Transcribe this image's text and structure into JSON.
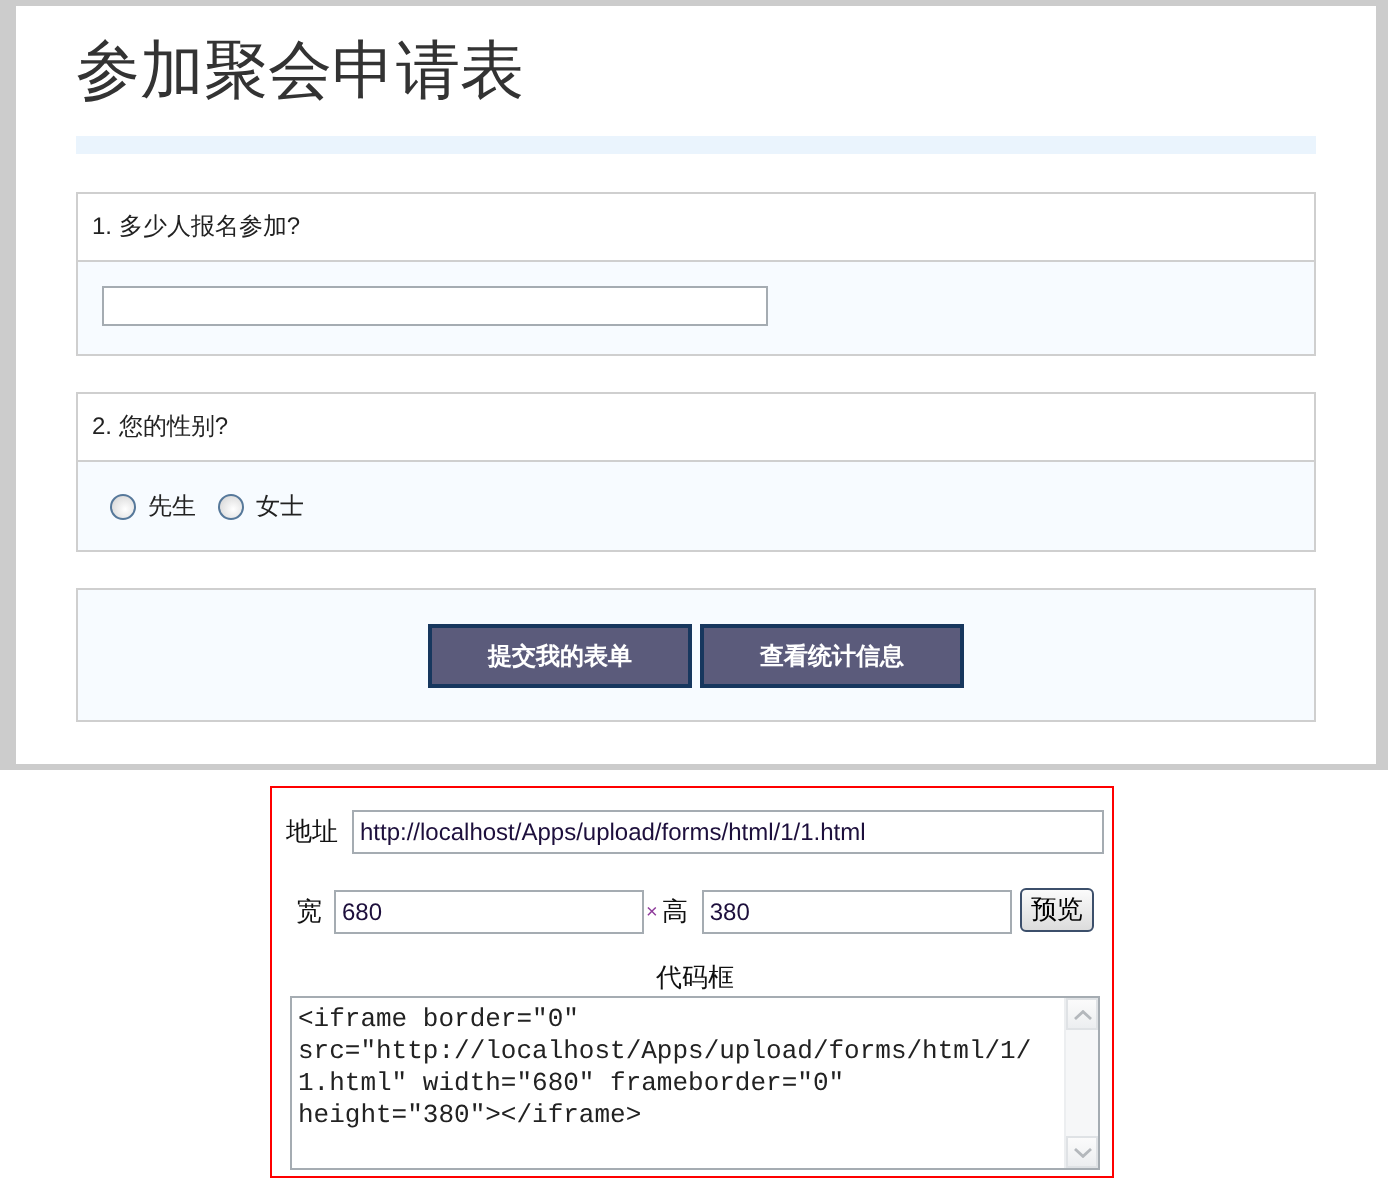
{
  "form": {
    "title": "参加聚会申请表",
    "questions": [
      {
        "kind": "text",
        "label": "1. 多少人报名参加?"
      },
      {
        "kind": "radio",
        "label": "2. 您的性别?",
        "options": [
          {
            "label": "先生",
            "selected": false
          },
          {
            "label": "女士",
            "selected": false
          }
        ]
      }
    ],
    "buttons": [
      "提交我的表单",
      "查看统计信息"
    ]
  },
  "embed_panel": {
    "address_label": "地址",
    "address_value": "http://localhost/Apps/upload/forms/html/1/1.html",
    "width_label": "宽",
    "width_value": "680",
    "times_sign": "×",
    "height_label": "高",
    "height_value": "380",
    "preview_button": "预览",
    "code_label": "代码框",
    "code_value": "<iframe border=\"0\" src=\"http://localhost/Apps/upload/forms/html/1/1.html\" width=\"680\" frameborder=\"0\" height=\"380\"></iframe>"
  }
}
